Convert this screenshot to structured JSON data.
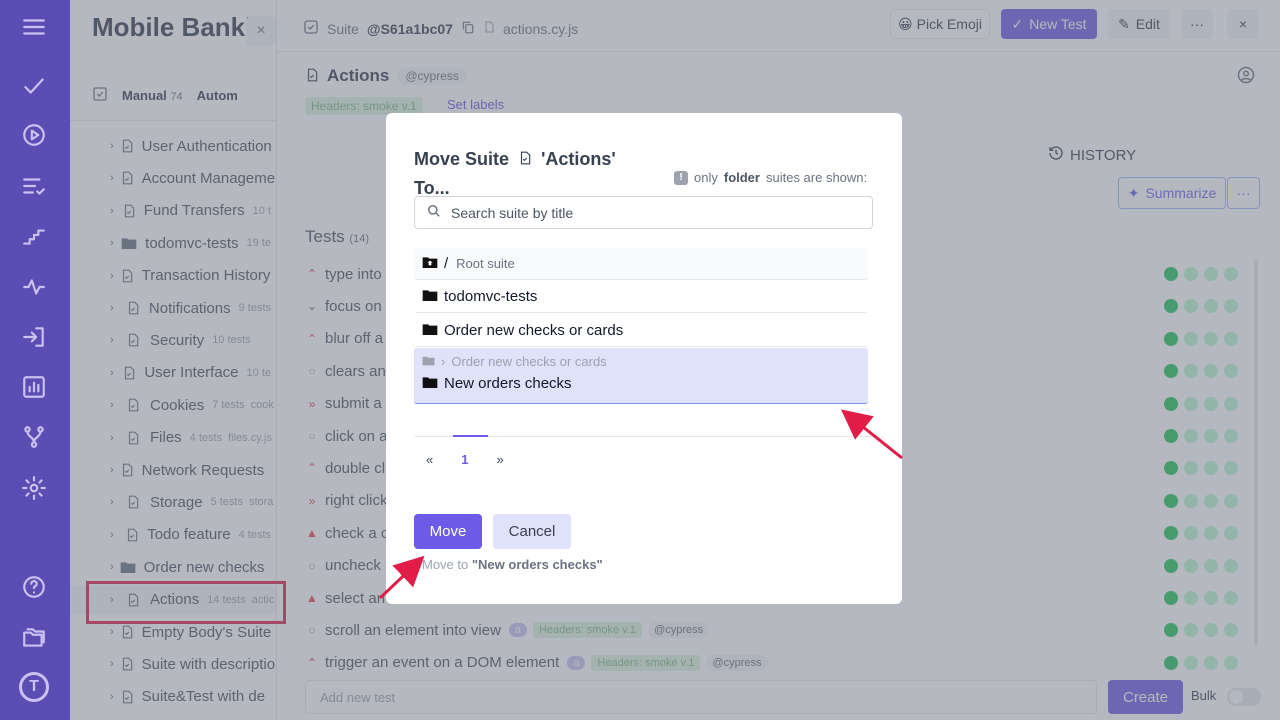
{
  "colors": {
    "accent": "#6d5ae6",
    "rail": "#5b4db3",
    "highlight": "#e11d48"
  },
  "rail": {
    "icons": [
      "menu-icon",
      "check-icon",
      "play-icon",
      "list-check-icon",
      "stairs-icon",
      "pulse-icon",
      "import-icon",
      "bar-chart-icon",
      "branch-icon",
      "gear-icon",
      "help-icon",
      "folders-icon"
    ],
    "logo": "T"
  },
  "sidebar": {
    "title": "Mobile Banking",
    "close": "×",
    "tabs": [
      {
        "label": "Manual",
        "count": "74"
      },
      {
        "label": "Autom"
      }
    ],
    "items": [
      {
        "label": "User Authentication",
        "type": "file",
        "count": "",
        "file": ""
      },
      {
        "label": "Account Management",
        "type": "file",
        "count": "",
        "file": ""
      },
      {
        "label": "Fund Transfers",
        "type": "file",
        "count": "10 t",
        "file": ""
      },
      {
        "label": "todomvc-tests",
        "type": "folder",
        "count": "19 te",
        "file": ""
      },
      {
        "label": "Transaction History",
        "type": "file",
        "count": "",
        "file": ""
      },
      {
        "label": "Notifications",
        "type": "file",
        "count": "9 tests",
        "file": ""
      },
      {
        "label": "Security",
        "type": "file",
        "count": "10 tests",
        "file": ""
      },
      {
        "label": "User Interface",
        "type": "file",
        "count": "10 te",
        "file": ""
      },
      {
        "label": "Cookies",
        "type": "file",
        "count": "7 tests",
        "file": "cook"
      },
      {
        "label": "Files",
        "type": "file",
        "count": "4 tests",
        "file": "files.cy.js"
      },
      {
        "label": "Network Requests",
        "type": "file",
        "count": "",
        "file": ""
      },
      {
        "label": "Storage",
        "type": "file",
        "count": "5 tests",
        "file": "stora"
      },
      {
        "label": "Todo feature",
        "type": "file",
        "count": "4 tests",
        "file": ""
      },
      {
        "label": "Order new checks",
        "type": "folder",
        "count": "",
        "file": ""
      },
      {
        "label": "Actions",
        "type": "file",
        "count": "14 tests",
        "file": "actic"
      },
      {
        "label": "Empty Body's Suite",
        "type": "file",
        "count": "",
        "file": ""
      },
      {
        "label": "Suite with description",
        "type": "file",
        "count": "",
        "file": ""
      },
      {
        "label": "Suite&Test with de",
        "type": "file",
        "count": "",
        "file": ""
      }
    ]
  },
  "topbar": {
    "suite_label": "Suite",
    "suite_id": "@S61a1bc07",
    "file": "actions.cy.js",
    "pick_emoji": "Pick Emoji",
    "new_test": "New Test",
    "edit": "Edit",
    "more": "···",
    "close": "×"
  },
  "page": {
    "title": "Actions",
    "tag": "@cypress",
    "header_tag": "Headers: smoke v.1",
    "set_labels": "Set labels",
    "history": "HISTORY",
    "summarize": "Summarize",
    "tests_label": "Tests",
    "tests_count": "(14)",
    "add_placeholder": "Add new test",
    "create": "Create",
    "bulk": "Bulk"
  },
  "tests": [
    {
      "title": "type into",
      "prio": "up",
      "badges": false
    },
    {
      "title": "focus on",
      "prio": "down",
      "badges": false
    },
    {
      "title": "blur off a",
      "prio": "up",
      "badges": false
    },
    {
      "title": "clears an",
      "prio": "none",
      "badges": false
    },
    {
      "title": "submit a",
      "prio": "high",
      "badges": false
    },
    {
      "title": "click on a",
      "prio": "none",
      "badges": false
    },
    {
      "title": "double cl",
      "prio": "up",
      "badges": false
    },
    {
      "title": "right click",
      "prio": "high",
      "badges": false
    },
    {
      "title": "check a c",
      "prio": "critical",
      "badges": false
    },
    {
      "title": "uncheck",
      "prio": "none",
      "badges": false
    },
    {
      "title": "select an",
      "prio": "critical",
      "badges": false
    },
    {
      "title": "scroll an element into view",
      "prio": "none",
      "badges": true,
      "a": "a",
      "header": "Headers: smoke v.1",
      "cy": "@cypress"
    },
    {
      "title": "trigger an event on a DOM element",
      "prio": "up",
      "badges": true,
      "a": "a",
      "header": "Headers: smoke v.1",
      "cy": "@cypress"
    }
  ],
  "modal": {
    "title_prefix": "Move Suite",
    "title_name": "'Actions'",
    "title_suffix": "To...",
    "note_pre": "only",
    "note_bold": "folder",
    "note_post": "suites are shown:",
    "search_placeholder": "Search suite by title",
    "root_slash": "/",
    "root_label": "Root suite",
    "options": [
      "todomvc-tests",
      "Order new checks or cards"
    ],
    "selected_parent": "Order new checks or cards",
    "selected": "New orders checks",
    "pager": {
      "prev": "«",
      "page": "1",
      "next": "»"
    },
    "move": "Move",
    "cancel": "Cancel",
    "move_to_label": "Move to",
    "move_to_value": "\"New orders checks\""
  }
}
